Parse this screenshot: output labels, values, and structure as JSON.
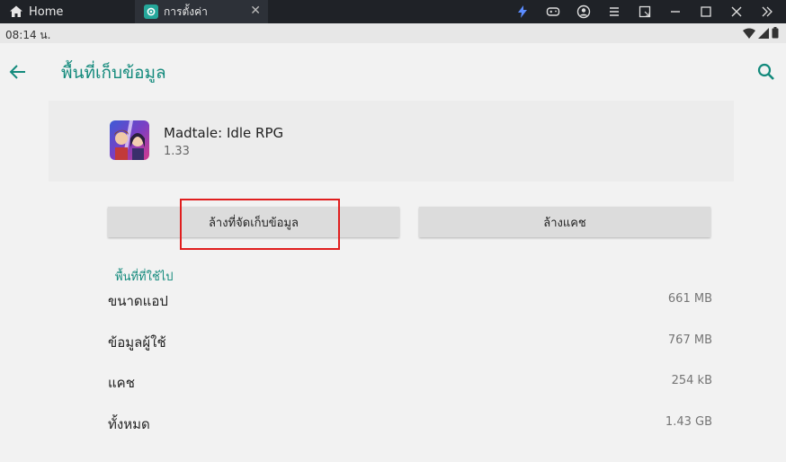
{
  "titlebar": {
    "home_label": "Home",
    "tab_label": "การตั้งค่า",
    "tab_close": "✕"
  },
  "statusbar": {
    "time": "08:14 น."
  },
  "appbar": {
    "title": "พื้นที่เก็บข้อมูล"
  },
  "app": {
    "name": "Madtale: Idle RPG",
    "version": "1.33"
  },
  "buttons": {
    "clear_storage": "ล้างที่จัดเก็บข้อมูล",
    "clear_cache": "ล้างแคช"
  },
  "storage": {
    "section_label": "พื้นที่ที่ใช้ไป",
    "rows": [
      {
        "label": "ขนาดแอป",
        "value": "661 MB"
      },
      {
        "label": "ข้อมูลผู้ใช้",
        "value": "767 MB"
      },
      {
        "label": "แคช",
        "value": "254 kB"
      },
      {
        "label": "ทั้งหมด",
        "value": "1.43 GB"
      }
    ]
  },
  "colors": {
    "accent": "#138a7c",
    "highlight": "#e01e1e",
    "titlebar_bg": "#1f2227"
  },
  "icons": [
    "home-icon",
    "settings-icon",
    "close-icon",
    "bolt-icon",
    "gamepad-icon",
    "account-icon",
    "menu-icon",
    "screen-icon",
    "minimize-icon",
    "maximize-icon",
    "window-close-icon",
    "chevrons-icon",
    "back-arrow-icon",
    "search-icon",
    "wifi-icon",
    "signal-icon",
    "battery-icon"
  ]
}
